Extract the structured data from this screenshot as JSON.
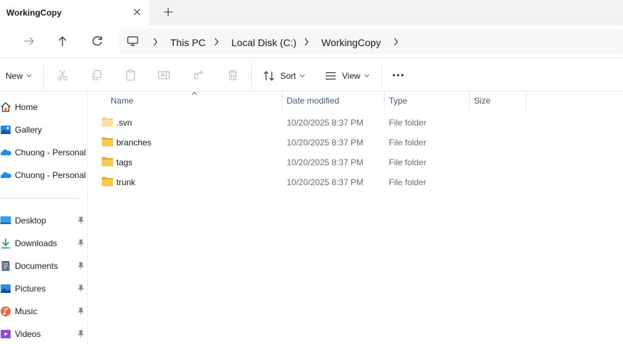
{
  "tab": {
    "title": "WorkingCopy"
  },
  "address": {
    "crumbs": [
      "This PC",
      "Local Disk (C:)",
      "WorkingCopy"
    ]
  },
  "commands": {
    "new": "New",
    "sort": "Sort",
    "view": "View"
  },
  "sidebar": {
    "items": [
      {
        "label": "Home",
        "icon": "home-icon"
      },
      {
        "label": "Gallery",
        "icon": "gallery-icon"
      },
      {
        "label": "Chuong - Personal",
        "icon": "onedrive-icon"
      },
      {
        "label": "Chuong - Personal",
        "icon": "onedrive-icon"
      }
    ],
    "pinned": [
      {
        "label": "Desktop",
        "icon": "desktop-icon"
      },
      {
        "label": "Downloads",
        "icon": "downloads-icon"
      },
      {
        "label": "Documents",
        "icon": "documents-icon"
      },
      {
        "label": "Pictures",
        "icon": "pictures-icon"
      },
      {
        "label": "Music",
        "icon": "music-icon"
      },
      {
        "label": "Videos",
        "icon": "videos-icon"
      }
    ]
  },
  "columns": [
    "Name",
    "Date modified",
    "Type",
    "Size"
  ],
  "files": [
    {
      "name": ".svn",
      "date": "10/20/2025 8:37 PM",
      "type": "File folder",
      "hidden": true
    },
    {
      "name": "branches",
      "date": "10/20/2025 8:37 PM",
      "type": "File folder",
      "hidden": false
    },
    {
      "name": "tags",
      "date": "10/20/2025 8:37 PM",
      "type": "File folder",
      "hidden": false
    },
    {
      "name": "trunk",
      "date": "10/20/2025 8:37 PM",
      "type": "File folder",
      "hidden": false
    }
  ],
  "colors": {
    "folder": "#f8c94c",
    "folder_dark": "#e6a925",
    "accent": "#0067c0",
    "header_text": "#3d5a80"
  }
}
